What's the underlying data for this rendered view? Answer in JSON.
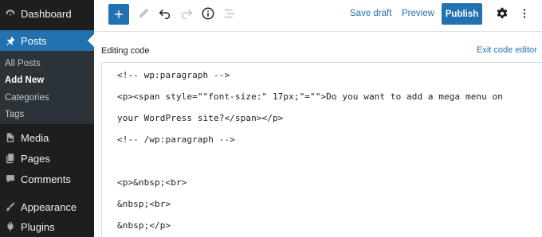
{
  "sidebar": {
    "items": [
      {
        "label": "Dashboard",
        "icon": "dashboard-icon"
      },
      {
        "label": "Posts",
        "icon": "pin-icon"
      },
      {
        "label": "Media",
        "icon": "media-icon"
      },
      {
        "label": "Pages",
        "icon": "pages-icon"
      },
      {
        "label": "Comments",
        "icon": "comments-icon"
      },
      {
        "label": "Appearance",
        "icon": "paintbrush-icon"
      },
      {
        "label": "Plugins",
        "icon": "plugin-icon"
      }
    ],
    "submenu": [
      "All Posts",
      "Add New",
      "Categories",
      "Tags"
    ],
    "accent": "#2271b1"
  },
  "toolbar": {
    "save_draft": "Save draft",
    "preview": "Preview",
    "publish": "Publish",
    "icons": [
      "plus-icon",
      "pencil-icon",
      "undo-icon",
      "redo-icon",
      "info-icon",
      "list-view-icon",
      "gear-icon",
      "more-vertical-icon"
    ]
  },
  "editor": {
    "editing_label": "Editing code",
    "exit_label": "Exit code editor",
    "lines": [
      "<!-- wp:paragraph -->",
      "<p><span style=\"\"font-size:\" 17px;\"=\"\">Do you want to add a mega menu on",
      "your WordPress site?</span></p>",
      "<!-- /wp:paragraph -->",
      "",
      "<p>&nbsp;<br>",
      "&nbsp;<br>",
      "&nbsp;</p>"
    ]
  }
}
